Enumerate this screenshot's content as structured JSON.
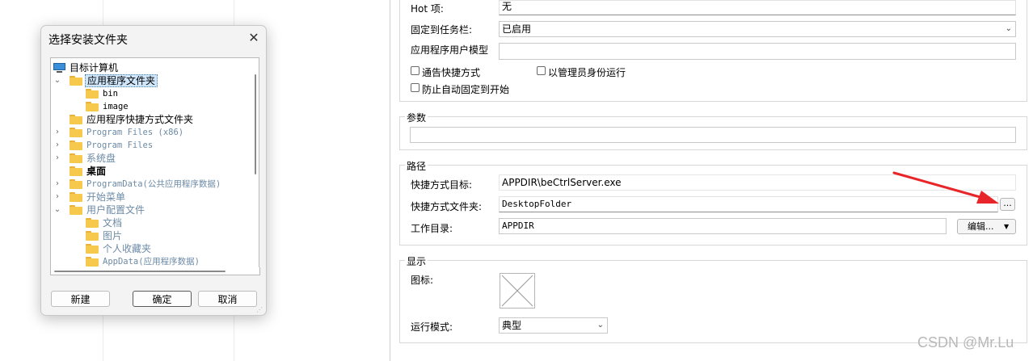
{
  "dialog": {
    "title": "选择安装文件夹",
    "close_glyph": "✕",
    "tree": {
      "root": "目标计算机",
      "items": [
        {
          "label": "应用程序文件夹"
        },
        {
          "label": "bin"
        },
        {
          "label": "image"
        },
        {
          "label": "应用程序快捷方式文件夹"
        },
        {
          "label": "Program Files (x86)"
        },
        {
          "label": "Program Files"
        },
        {
          "label": "系统盘"
        },
        {
          "label": "桌面"
        },
        {
          "label": "ProgramData(公共应用程序数据)"
        },
        {
          "label": "开始菜单"
        },
        {
          "label": "用户配置文件"
        },
        {
          "label": "文档"
        },
        {
          "label": "图片"
        },
        {
          "label": "个人收藏夹"
        },
        {
          "label": "AppData(应用程序数据)"
        }
      ]
    },
    "buttons": {
      "new": "新建",
      "ok": "确定",
      "cancel": "取消"
    }
  },
  "properties": {
    "hotkey": {
      "label": "Hot 项:",
      "value": "无"
    },
    "pin_taskbar": {
      "label": "固定到任务栏:",
      "value": "已启用"
    },
    "app_user_model": {
      "label": "应用程序用户模型",
      "value": ""
    },
    "checkboxes": {
      "notify_shortcut": "通告快捷方式",
      "run_as_admin": "以管理员身份运行",
      "prevent_autopin": "防止自动固定到开始"
    },
    "params": {
      "title": "参数",
      "value": ""
    },
    "path": {
      "title": "路径",
      "target_label": "快捷方式目标:",
      "target_value": "APPDIR\\beCtrlServer.exe",
      "folder_label": "快捷方式文件夹:",
      "folder_value": "DesktopFolder",
      "browse_label": "...",
      "workdir_label": "工作目录:",
      "workdir_value": "APPDIR",
      "edit_label": "编辑..."
    },
    "display": {
      "title": "显示",
      "icon_label": "图标:",
      "run_mode_label": "运行模式:",
      "run_mode_value": "典型"
    }
  },
  "annotation": {
    "color": "#e8262a"
  },
  "watermark": "CSDN @Mr.Lu"
}
